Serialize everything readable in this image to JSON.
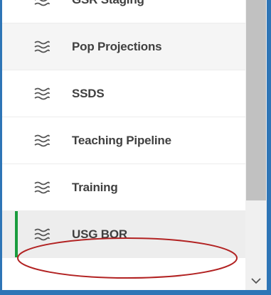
{
  "list": {
    "items": [
      {
        "label": "GSR Staging",
        "icon": "stream-icon"
      },
      {
        "label": "Pop Projections",
        "icon": "stream-icon"
      },
      {
        "label": "SSDS",
        "icon": "stream-icon"
      },
      {
        "label": "Teaching Pipeline",
        "icon": "stream-icon"
      },
      {
        "label": "Training",
        "icon": "stream-icon"
      },
      {
        "label": "USG BOR",
        "icon": "stream-icon",
        "selected": true
      }
    ]
  },
  "colors": {
    "frame_border": "#2e75b6",
    "selected_accent": "#1a9c3e",
    "annotation_ellipse": "#b22222",
    "label_text": "#404040"
  },
  "scrollbar": {
    "down_arrow_icon": "chevron-down-icon"
  }
}
